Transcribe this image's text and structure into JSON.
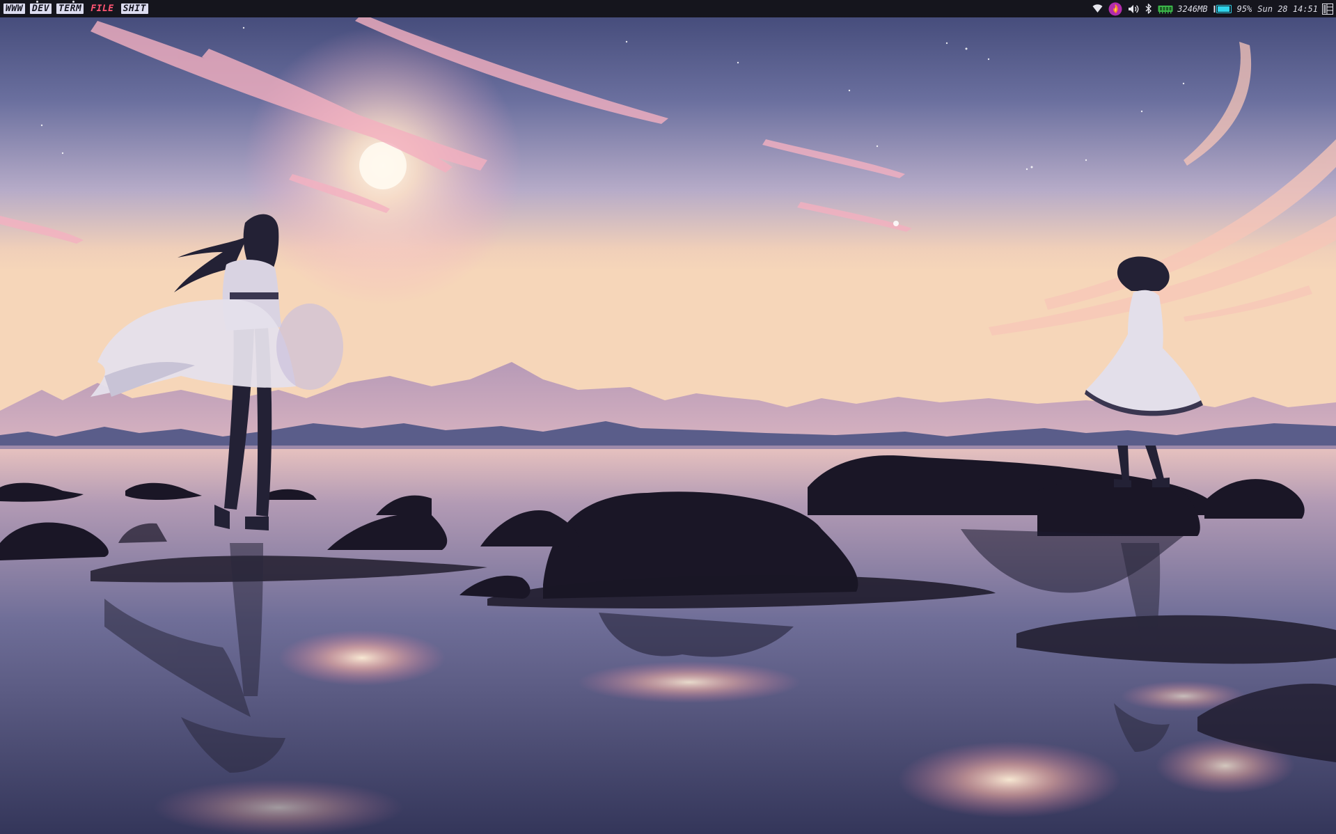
{
  "workspaces": [
    {
      "label": "WWW",
      "active": false
    },
    {
      "label": "DEV",
      "active": false
    },
    {
      "label": "TERM",
      "active": false
    },
    {
      "label": "FILE",
      "active": true
    },
    {
      "label": "SHIT",
      "active": false
    }
  ],
  "tray": {
    "icons": [
      "wifi-icon",
      "firefox-icon",
      "volume-icon",
      "bluetooth-icon",
      "memory-icon",
      "battery-icon",
      "layout-icon"
    ],
    "memory": "3246MB",
    "battery_percent": "95%",
    "battery_level": 0.95,
    "datetime": "Sun 28 14:51"
  },
  "colors": {
    "bar_bg": "#15151d",
    "workspace_bg": "#dcdcef",
    "workspace_active": "#ff5573",
    "memory_accent": "#3bb54a",
    "battery_accent": "#2fd3ea",
    "browser_accent": "#c42da8"
  }
}
